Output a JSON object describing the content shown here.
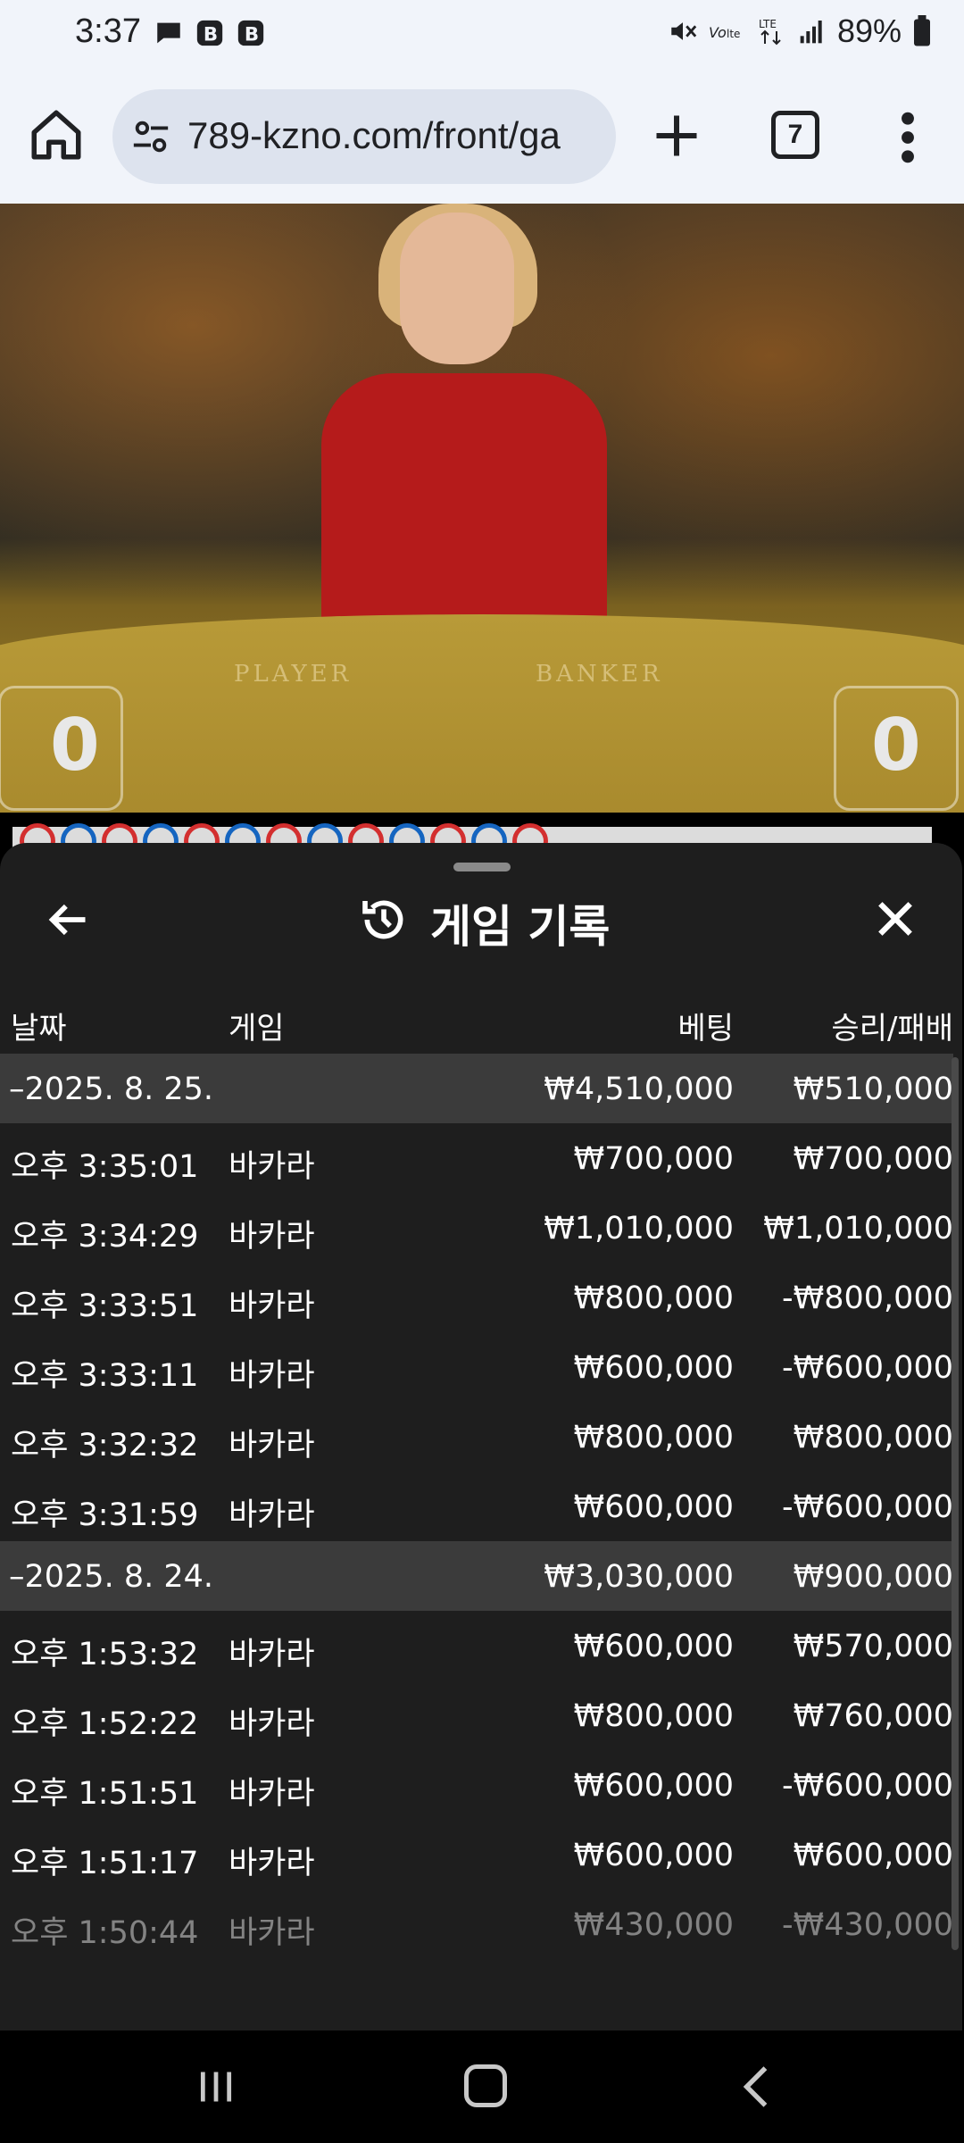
{
  "status_bar": {
    "time": "3:37",
    "battery": "89%",
    "icons": [
      "chat-icon",
      "b-app-icon",
      "b-app-icon",
      "mute-icon",
      "volte-icon",
      "lte-icon",
      "signal-icon",
      "battery-icon"
    ]
  },
  "browser": {
    "url": "789-kzno.com/front/ga",
    "tab_count": "7",
    "icons": [
      "home-icon",
      "site-settings-icon",
      "plus-icon",
      "tabs-icon",
      "more-vert-icon"
    ]
  },
  "video": {
    "player_label": "PLAYER",
    "banker_label": "BANKER",
    "player_score": "0",
    "banker_score": "0"
  },
  "sheet": {
    "title": "게임 기록",
    "columns": {
      "date": "날짜",
      "game": "게임",
      "bet": "베팅",
      "win_loss": "승리/패배"
    },
    "groups": [
      {
        "date": "–2025. 8. 25.",
        "bet_total": "₩4,510,000",
        "win_total": "₩510,000",
        "rows": [
          {
            "time": "오후 3:35:01",
            "game": "바카라",
            "bet": "₩700,000",
            "win": "₩700,000"
          },
          {
            "time": "오후 3:34:29",
            "game": "바카라",
            "bet": "₩1,010,000",
            "win": "₩1,010,000"
          },
          {
            "time": "오후 3:33:51",
            "game": "바카라",
            "bet": "₩800,000",
            "win": "-₩800,000"
          },
          {
            "time": "오후 3:33:11",
            "game": "바카라",
            "bet": "₩600,000",
            "win": "-₩600,000"
          },
          {
            "time": "오후 3:32:32",
            "game": "바카라",
            "bet": "₩800,000",
            "win": "₩800,000"
          },
          {
            "time": "오후 3:31:59",
            "game": "바카라",
            "bet": "₩600,000",
            "win": "-₩600,000"
          }
        ]
      },
      {
        "date": "–2025. 8. 24.",
        "bet_total": "₩3,030,000",
        "win_total": "₩900,000",
        "rows": [
          {
            "time": "오후 1:53:32",
            "game": "바카라",
            "bet": "₩600,000",
            "win": "₩570,000"
          },
          {
            "time": "오후 1:52:22",
            "game": "바카라",
            "bet": "₩800,000",
            "win": "₩760,000"
          },
          {
            "time": "오후 1:51:51",
            "game": "바카라",
            "bet": "₩600,000",
            "win": "-₩600,000"
          },
          {
            "time": "오후 1:51:17",
            "game": "바카라",
            "bet": "₩600,000",
            "win": "₩600,000"
          },
          {
            "time": "오후 1:50:44",
            "game": "바카라",
            "bet": "₩430,000",
            "win": "-₩430,000"
          }
        ]
      }
    ]
  }
}
